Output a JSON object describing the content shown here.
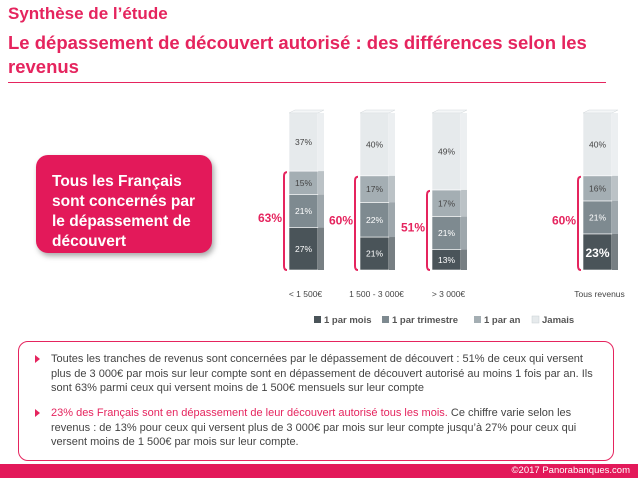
{
  "header": {
    "title_line1": "Synthèse de l’étude",
    "title_line2": "Le dépassement de découvert autorisé : des différences selon les revenus"
  },
  "callout": {
    "text": "Tous les Français sont concernés par le dépassement de découvert"
  },
  "colors": {
    "accent": "#e5245e",
    "par_mois": "#4a5459",
    "par_trimestre": "#7e8a90",
    "par_an": "#a4aeb3",
    "jamais": "#e6eaec"
  },
  "chart_data": {
    "type": "bar",
    "stacked": true,
    "categories": [
      "< 1 500€",
      "1 500 - 3 000€",
      "> 3 000€",
      "Tous revenus"
    ],
    "series": [
      {
        "name": "1 par mois",
        "values": [
          27,
          21,
          13,
          23
        ]
      },
      {
        "name": "1 par trimestre",
        "values": [
          21,
          22,
          21,
          21
        ]
      },
      {
        "name": "1 par an",
        "values": [
          15,
          17,
          17,
          16
        ]
      },
      {
        "name": "Jamais",
        "values": [
          37,
          40,
          49,
          40
        ]
      }
    ],
    "bracket_totals": [
      "63%",
      "60%",
      "51%",
      "60%"
    ],
    "ylim": [
      0,
      100
    ],
    "legend_position": "bottom"
  },
  "bullets": [
    {
      "text": "Toutes les tranches de revenus sont concernées par le dépassement de découvert : 51% de ceux qui versent plus de 3 000€ par mois sur leur compte sont en dépassement de découvert autorisé au moins 1 fois par an. Ils sont 63% parmi ceux qui versent moins de 1 500€ mensuels sur leur compte"
    },
    {
      "highlight": "23% des Français sont en dépassement de leur découvert autorisé tous les mois.",
      "text": " Ce chiffre varie selon les revenus : de 13% pour ceux qui versent plus de 3 000€ par mois sur leur compte jusqu’à 27% pour ceux qui versent moins de 1 500€ par mois sur leur compte."
    }
  ],
  "footer": {
    "copyright": "©2017 Panorabanques.com"
  }
}
